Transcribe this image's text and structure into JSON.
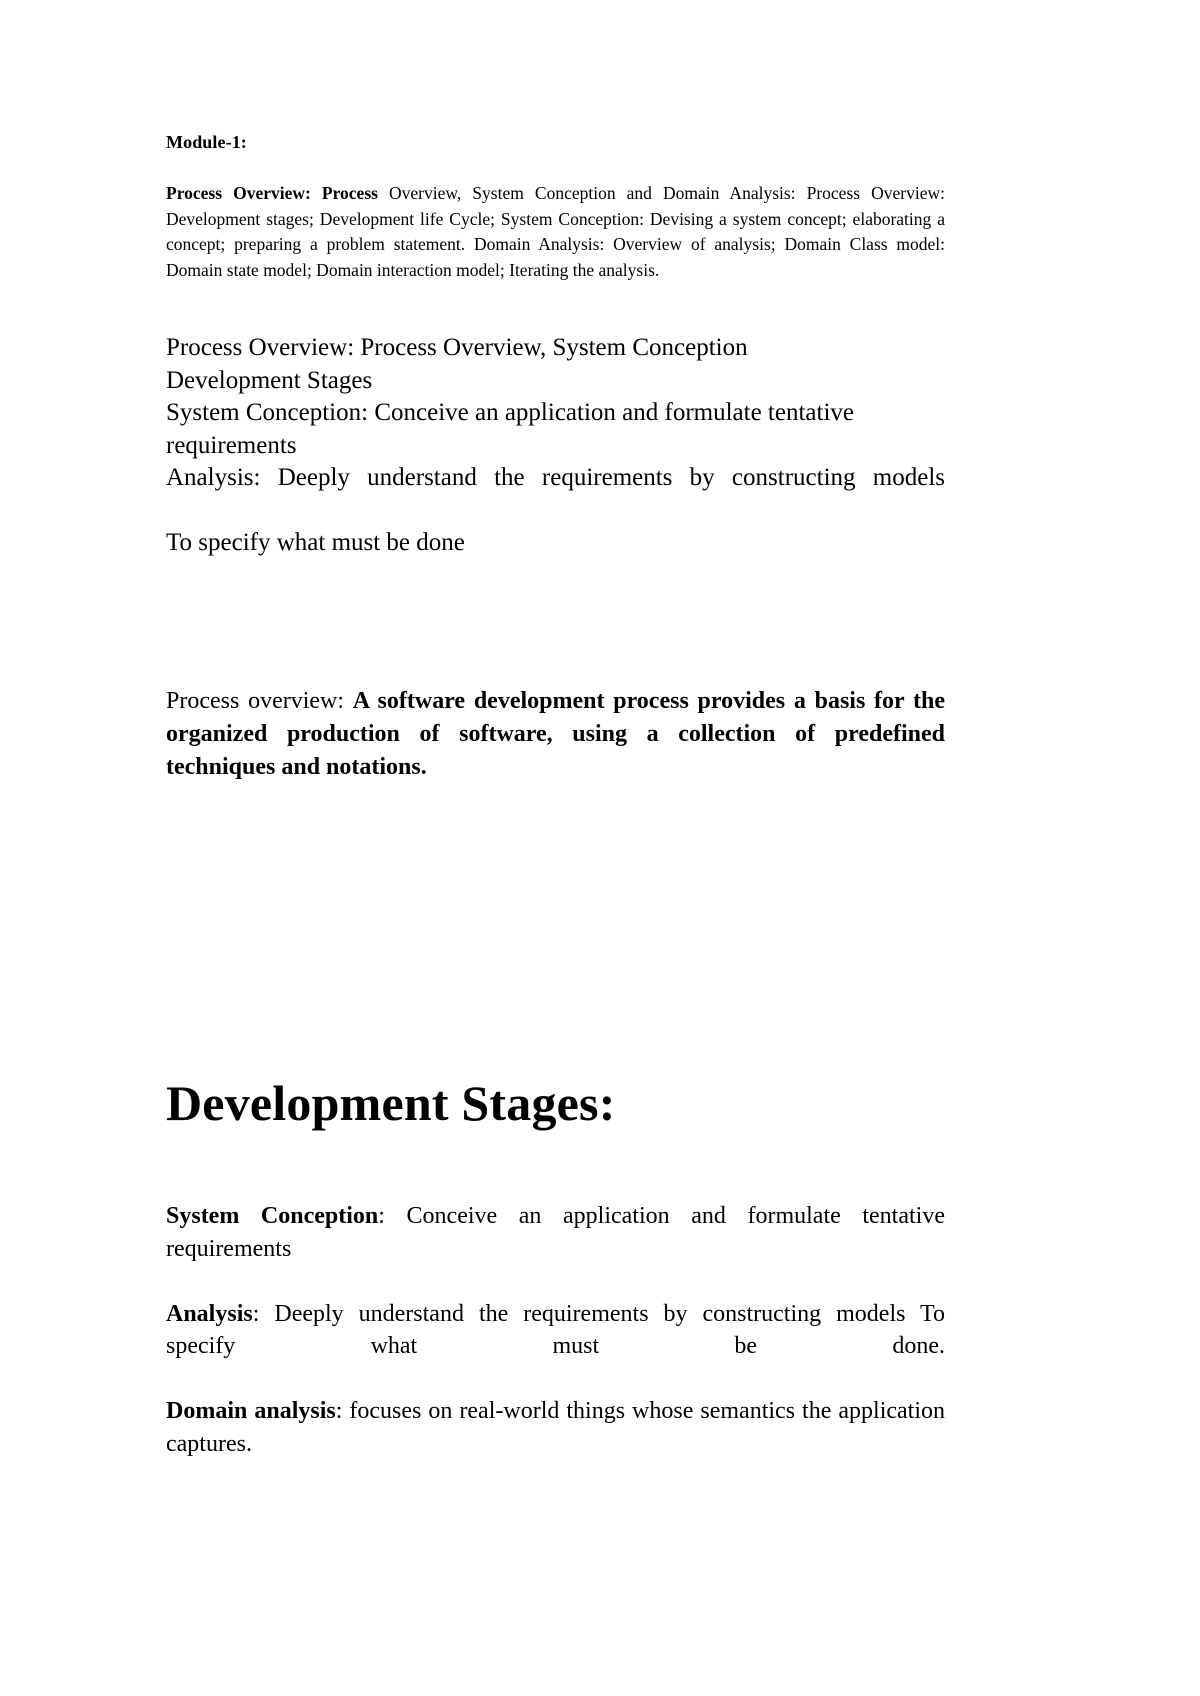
{
  "document": {
    "page_background": "#ffffff",
    "text_color": "#000000"
  },
  "module": {
    "title": "Module-1:"
  },
  "syllabus": {
    "bold_lead": "Process Overview: Process",
    "body": " Overview, System Conception and Domain Analysis: Process Overview: Development stages; Development life Cycle; System Conception: Devising a system concept; elaborating a concept; preparing a problem statement. Domain Analysis: Overview of analysis; Domain Class model: Domain state model; Domain interaction model; Iterating the analysis."
  },
  "overview_block": {
    "line1": "Process Overview: Process Overview, System Conception",
    "line2": "Development Stages",
    "line3": "System Conception: Conceive an application and formulate tentative requirements",
    "line4": "Analysis: Deeply understand the requirements by constructing models",
    "line5": "To specify what must be done"
  },
  "definition": {
    "lead": "Process overview: ",
    "bold_text": "A software development process provides a basis for the organized production of software, using  a collection of predefined techniques and notations."
  },
  "big_heading": {
    "text": "Development Stages:"
  },
  "stages": {
    "items": [
      {
        "term": "System Conception",
        "separator": ": ",
        "description": "Conceive an application and formulate tentative requirements"
      },
      {
        "term": "Analysis",
        "separator": ": ",
        "description": "Deeply understand the requirements by constructing models To specify what must be done."
      },
      {
        "term": "Domain analysis",
        "separator": ": ",
        "description": "focuses on real-world things whose semantics the application captures."
      }
    ]
  }
}
